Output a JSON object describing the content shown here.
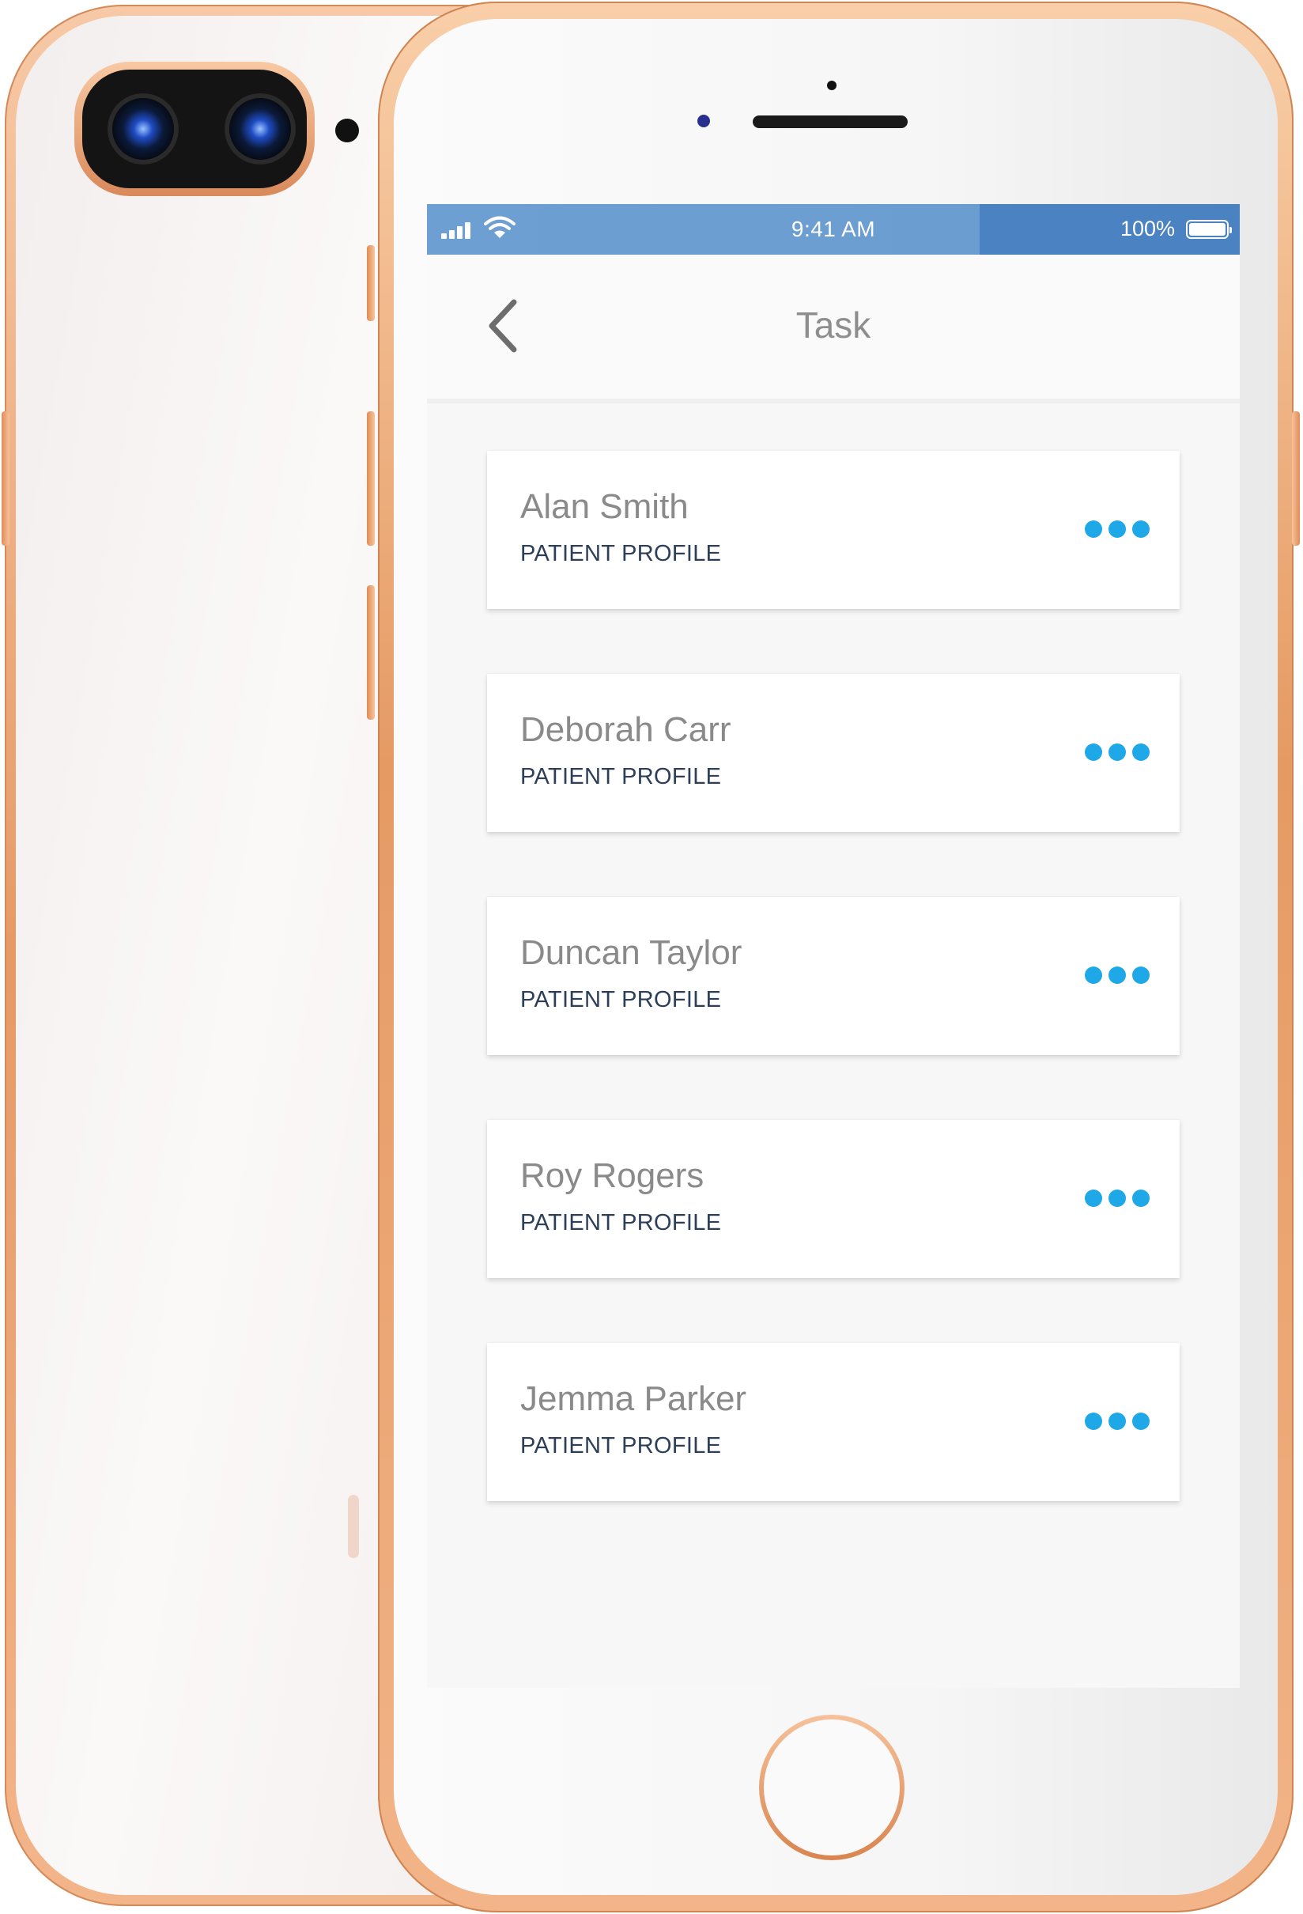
{
  "status_bar": {
    "time": "9:41 AM",
    "battery": "100%",
    "signal_icon": "signal-bars-icon",
    "wifi_icon": "wifi-icon",
    "battery_icon": "battery-icon"
  },
  "nav": {
    "title": "Task",
    "back_icon": "chevron-left-icon"
  },
  "patients": [
    {
      "name": "Alan Smith",
      "subtitle": "PATIENT PROFILE"
    },
    {
      "name": "Deborah Carr",
      "subtitle": "PATIENT PROFILE"
    },
    {
      "name": "Duncan Taylor",
      "subtitle": "PATIENT PROFILE"
    },
    {
      "name": "Roy Rogers",
      "subtitle": "PATIENT PROFILE"
    },
    {
      "name": "Jemma Parker",
      "subtitle": "PATIENT PROFILE"
    }
  ],
  "colors": {
    "accent": "#1fa8e8",
    "status_bar": "#6b9dd1",
    "phone_frame": "#e59a63"
  }
}
